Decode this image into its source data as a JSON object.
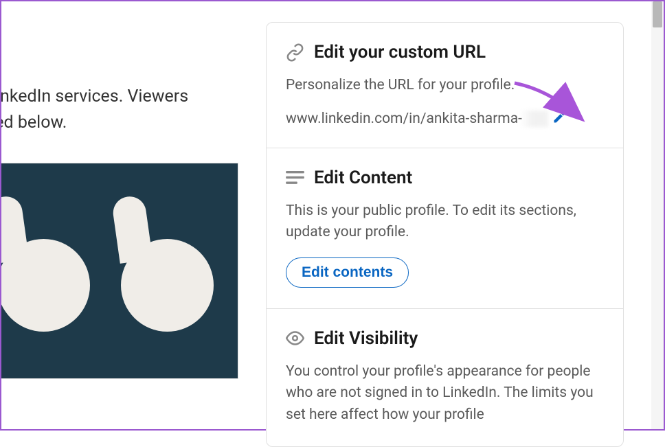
{
  "left": {
    "text_line1": "er off-LinkedIn services. Viewers",
    "text_line2": " displayed below."
  },
  "url_section": {
    "title": "Edit your custom URL",
    "description": "Personalize the URL for your profile.",
    "url": "www.linkedin.com/in/ankita-sharma-"
  },
  "content_section": {
    "title": "Edit Content",
    "description": "This is your public profile. To edit its sections, update your profile.",
    "button_label": "Edit contents"
  },
  "visibility_section": {
    "title": "Edit Visibility",
    "description": "You control your profile's appearance for people who are not signed in to LinkedIn. The limits you set here affect how your profile"
  }
}
